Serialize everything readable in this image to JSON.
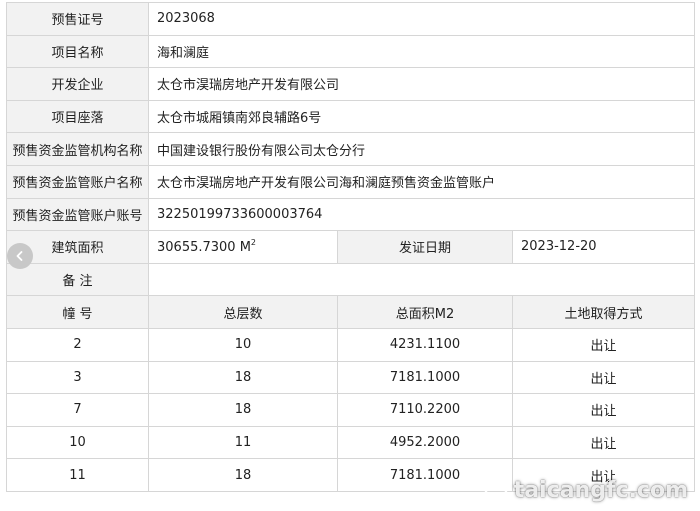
{
  "info": {
    "presale_no": {
      "label": "预售证号",
      "value": "2023068"
    },
    "project_name": {
      "label": "项目名称",
      "value": "海和澜庭"
    },
    "developer": {
      "label": "开发企业",
      "value": "太仓市淏瑞房地产开发有限公司"
    },
    "location": {
      "label": "项目座落",
      "value": "太仓市城厢镇南郊良辅路6号"
    },
    "supervisor_org": {
      "label": "预售资金监管机构名称",
      "value": "中国建设银行股份有限公司太仓分行"
    },
    "account_name": {
      "label": "预售资金监管账户名称",
      "value": "太仓市淏瑞房地产开发有限公司海和澜庭预售资金监管账户"
    },
    "account_no": {
      "label": "预售资金监管账户账号",
      "value": "32250199733600003764"
    },
    "building_area": {
      "label": "建筑面积",
      "value": "30655.7300 M",
      "unit_sup": "2"
    },
    "issue_date": {
      "label": "发证日期",
      "value": "2023-12-20"
    },
    "remarks": {
      "label": "备 注",
      "value": ""
    }
  },
  "buildings_table": {
    "headers": [
      "幢 号",
      "总层数",
      "总面积M2",
      "土地取得方式"
    ],
    "rows": [
      [
        "2",
        "10",
        "4231.1100",
        "出让"
      ],
      [
        "3",
        "18",
        "7181.1000",
        "出让"
      ],
      [
        "7",
        "18",
        "7110.2200",
        "出让"
      ],
      [
        "10",
        "11",
        "4952.2000",
        "出让"
      ],
      [
        "11",
        "18",
        "7181.1000",
        "出让"
      ]
    ]
  },
  "watermark": {
    "text": "taicangfc.com"
  },
  "icons": {
    "back": "chevron-left-icon",
    "watermark_logo": "smile-logo-icon"
  }
}
